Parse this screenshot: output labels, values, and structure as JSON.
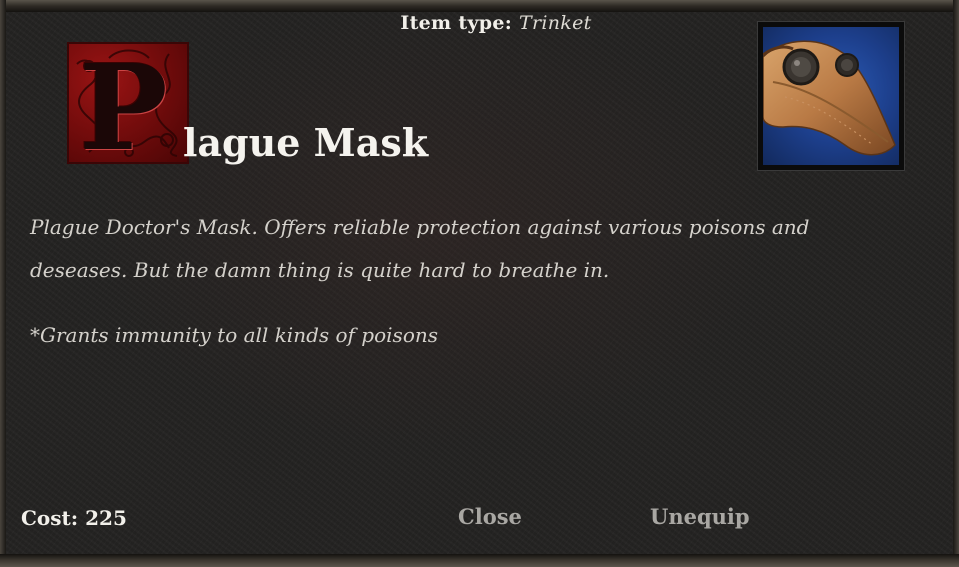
{
  "header": {
    "item_type_label": "Item type:",
    "item_type_value": "Trinket"
  },
  "item": {
    "title_initial": "P",
    "title_rest": "lague Mask",
    "portrait_icon": "plague-doctor-mask-icon",
    "description": "Plague Doctor's Mask. Offers reliable protection against various poisons and deseases. But the damn thing is quite hard to breathe in.",
    "effect_note": "*Grants immunity to all kinds of poisons"
  },
  "footer": {
    "cost_label": "Cost:",
    "cost_value": "225",
    "close_label": "Close",
    "unequip_label": "Unequip"
  },
  "colors": {
    "dropcap_red": "#8a1010",
    "portrait_blue": "#1d3f8c",
    "title_text": "#f5f3ee",
    "button_text": "#a9a7a3"
  }
}
